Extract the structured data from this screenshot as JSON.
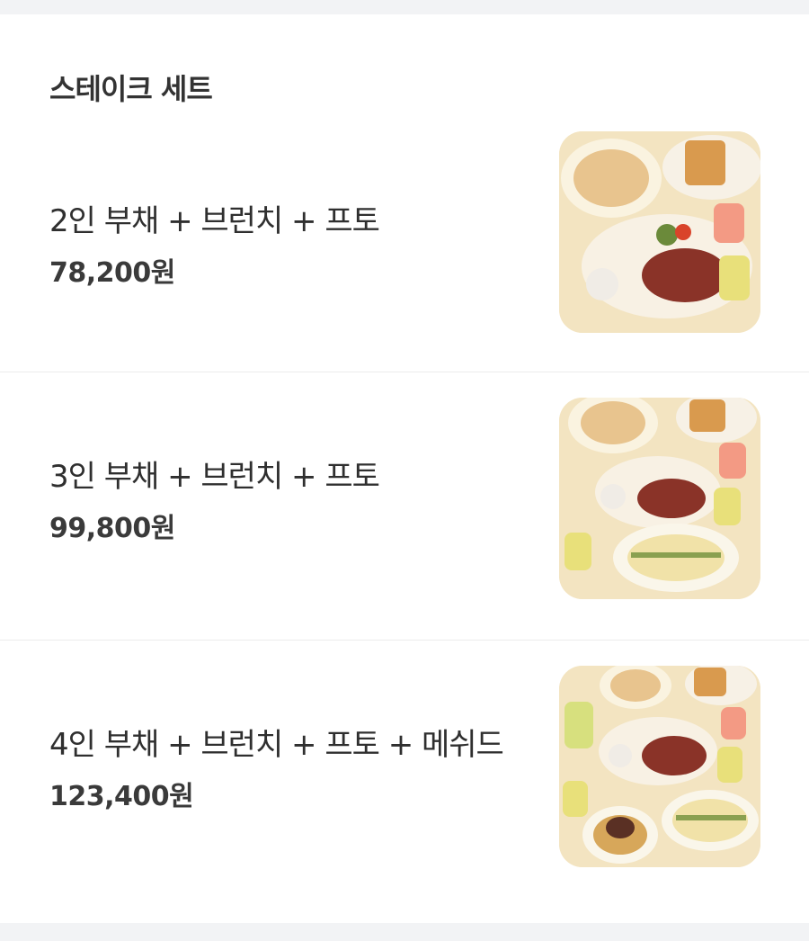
{
  "section": {
    "title": "스테이크 세트"
  },
  "menu_items": [
    {
      "name": "2인 부채 + 브런치 + 프토",
      "price": "78,200원",
      "image": "two-person-set-photo"
    },
    {
      "name": "3인 부채 + 브런치 + 프토",
      "price": "99,800원",
      "image": "three-person-set-photo"
    },
    {
      "name": "4인 부채 + 브런치 + 프토 + 메쉬드",
      "price": "123,400원",
      "image": "four-person-set-photo"
    }
  ]
}
